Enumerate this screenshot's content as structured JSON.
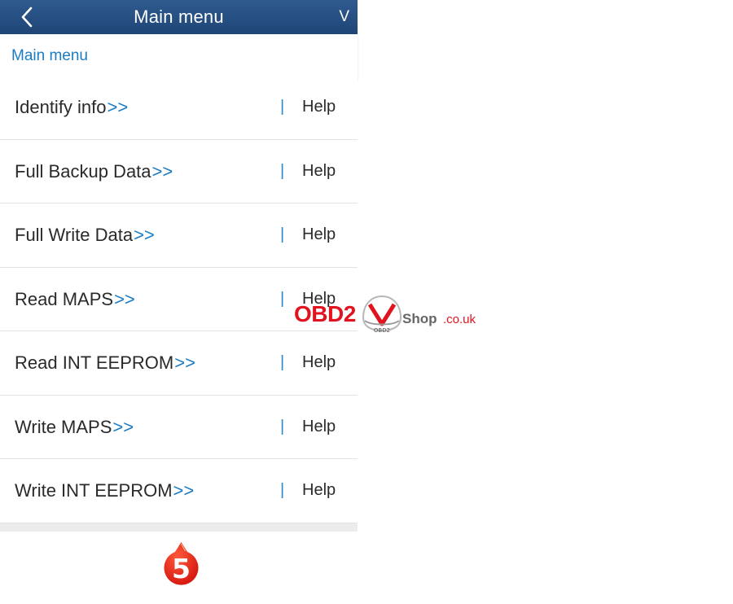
{
  "header": {
    "title": "Main menu",
    "right_label": "V"
  },
  "breadcrumb": {
    "label": "Main menu"
  },
  "menu": {
    "items": [
      {
        "label": "Identify info",
        "arrow": ">>",
        "separator": "|",
        "help": "Help"
      },
      {
        "label": "Full Backup Data",
        "arrow": ">>",
        "separator": "|",
        "help": "Help"
      },
      {
        "label": "Full Write Data",
        "arrow": ">>",
        "separator": "|",
        "help": "Help"
      },
      {
        "label": "Read MAPS",
        "arrow": ">>",
        "separator": "|",
        "help": "Help"
      },
      {
        "label": "Read INT EEPROM",
        "arrow": ">>",
        "separator": "|",
        "help": "Help"
      },
      {
        "label": "Write MAPS",
        "arrow": ">>",
        "separator": "|",
        "help": "Help"
      },
      {
        "label": "Write INT EEPROM",
        "arrow": ">>",
        "separator": "|",
        "help": "Help"
      }
    ]
  },
  "step_badge": {
    "number": "5",
    "color": "#e3221b"
  },
  "watermark": {
    "brand": "OBD2",
    "car_text": "OBD2",
    "shop": "Shop",
    "domain": ".co.uk"
  },
  "colors": {
    "header_bg": "#25507f",
    "link_blue": "#1c7cc3",
    "brand_red": "#e1131e"
  }
}
